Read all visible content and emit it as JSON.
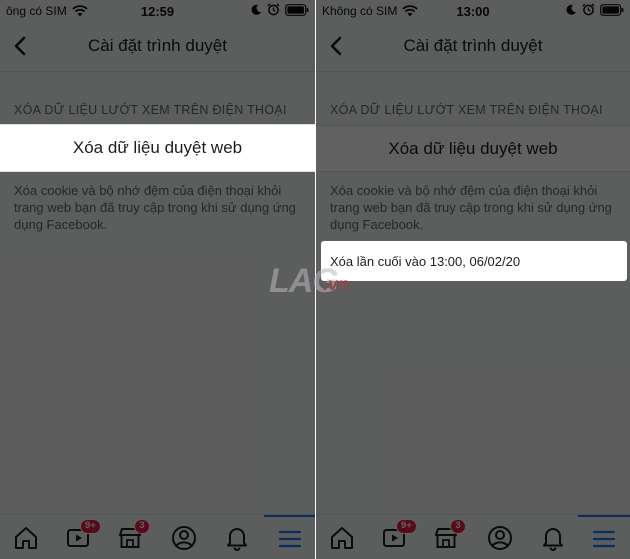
{
  "left": {
    "status": {
      "carrier": "ông có SIM",
      "time": "12:59"
    },
    "nav": {
      "title": "Cài đặt trình duyệt"
    },
    "section_header": "XÓA DỮ LIỆU LƯỚT XEM TRÊN ĐIỆN THOẠI",
    "clear_button_label": "Xóa dữ liệu duyệt web",
    "description": "Xóa cookie và bộ nhớ đệm của điện thoại khỏi trang web bạn đã truy cập trong khi sử dụng ứng dụng Facebook.",
    "tabbar": {
      "watch_badge": "9+",
      "marketplace_badge": "3"
    }
  },
  "right": {
    "status": {
      "carrier": "Không có SIM",
      "time": "13:00"
    },
    "nav": {
      "title": "Cài đặt trình duyệt"
    },
    "section_header": "XÓA DỮ LIỆU LƯỚT XEM TRÊN ĐIỆN THOẠI",
    "clear_button_label": "Xóa dữ liệu duyệt web",
    "description": "Xóa cookie và bộ nhớ đệm của điện thoại khỏi trang web bạn đã truy cập trong khi sử dụng ứng dụng Facebook.",
    "toast": "Xóa lần cuối vào 13:00, 06/02/20",
    "tabbar": {
      "watch_badge": "9+",
      "marketplace_badge": "3"
    }
  },
  "watermark": {
    "main": "LAG",
    "sub": ".vn"
  },
  "colors": {
    "overlay": "#000000",
    "badge": "#e41e3f",
    "active_tab": "#1877f2"
  },
  "icons": [
    "wifi-icon",
    "moon-icon",
    "alarm-icon",
    "battery-icon",
    "back-chevron-icon",
    "home-icon",
    "watch-icon",
    "marketplace-icon",
    "profile-icon",
    "bell-icon",
    "menu-icon"
  ]
}
